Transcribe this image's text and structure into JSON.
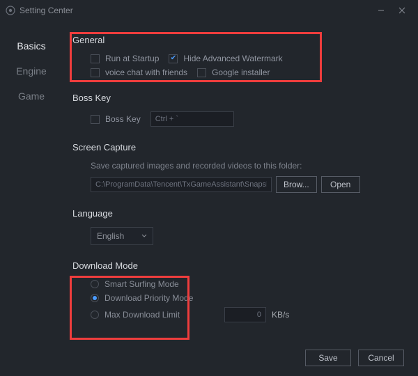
{
  "window": {
    "title": "Setting Center"
  },
  "sidebar": {
    "items": [
      {
        "label": "Basics",
        "active": true
      },
      {
        "label": "Engine",
        "active": false
      },
      {
        "label": "Game",
        "active": false
      }
    ]
  },
  "general": {
    "title": "General",
    "run_at_startup": "Run at Startup",
    "hide_watermark": "Hide Advanced Watermark",
    "voice_chat": "voice chat with friends",
    "google_installer": "Google installer",
    "checked": {
      "hide_watermark": true
    }
  },
  "bosskey": {
    "title": "Boss Key",
    "label": "Boss Key",
    "value": "Ctrl + `"
  },
  "screencap": {
    "title": "Screen Capture",
    "hint": "Save captured images and recorded videos to this folder:",
    "path": "C:\\ProgramData\\Tencent\\TxGameAssistant\\Snapshot",
    "browse": "Brow...",
    "open": "Open"
  },
  "language": {
    "title": "Language",
    "value": "English"
  },
  "download": {
    "title": "Download Mode",
    "smart": "Smart Surfing Mode",
    "priority": "Download Priority Mode",
    "max_limit": "Max Download Limit",
    "selected": "priority",
    "limit_value": "0",
    "limit_unit": "KB/s"
  },
  "footer": {
    "save": "Save",
    "cancel": "Cancel"
  }
}
